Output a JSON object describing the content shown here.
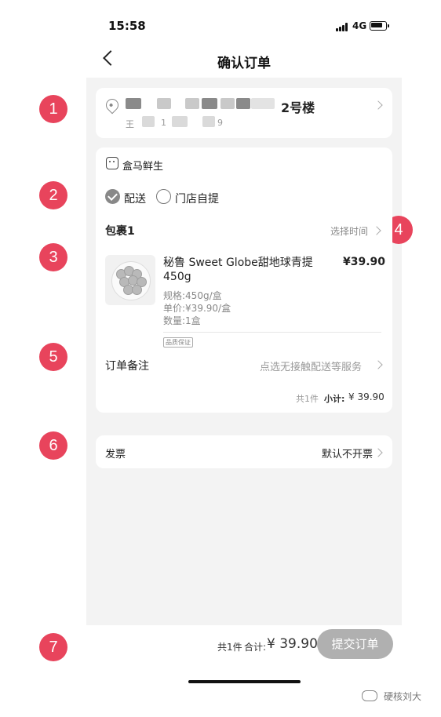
{
  "status_bar": {
    "time": "15:58",
    "network": "4G"
  },
  "nav": {
    "title": "确认订单"
  },
  "address": {
    "building": "2号楼",
    "name_initial": "王",
    "phone_fragment_a": "1",
    "phone_fragment_b": "9"
  },
  "store": {
    "name": "盒马鲜生"
  },
  "delivery": {
    "option_delivery": "配送",
    "option_pickup": "门店自提",
    "selected": "配送"
  },
  "package": {
    "title": "包裹1",
    "select_time": "选择时间"
  },
  "product": {
    "name": "秘鲁 Sweet Globe甜地球青提 450g",
    "price": "¥39.90",
    "spec": "规格:450g/盒",
    "unit_price": "单价:¥39.90/盒",
    "quantity": "数量:1盒",
    "badge": "品质保证"
  },
  "order_note": {
    "label": "订单备注",
    "hint": "点选无接触配送等服务"
  },
  "subtotal": {
    "count": "共1件",
    "label": "小计:",
    "value": "¥ 39.90"
  },
  "invoice": {
    "label": "发票",
    "value": "默认不开票"
  },
  "footer": {
    "count": "共1件",
    "total_label": "合计:",
    "total_value": "¥ 39.90",
    "submit_label": "提交订单"
  },
  "annotations": [
    "1",
    "2",
    "3",
    "4",
    "5",
    "6",
    "7"
  ],
  "watermark": {
    "text": "硬核刘大"
  },
  "colors": {
    "annotation": "#e8445c",
    "submit_disabled": "#b0b0b0",
    "content_bg": "#f3f3f3"
  }
}
